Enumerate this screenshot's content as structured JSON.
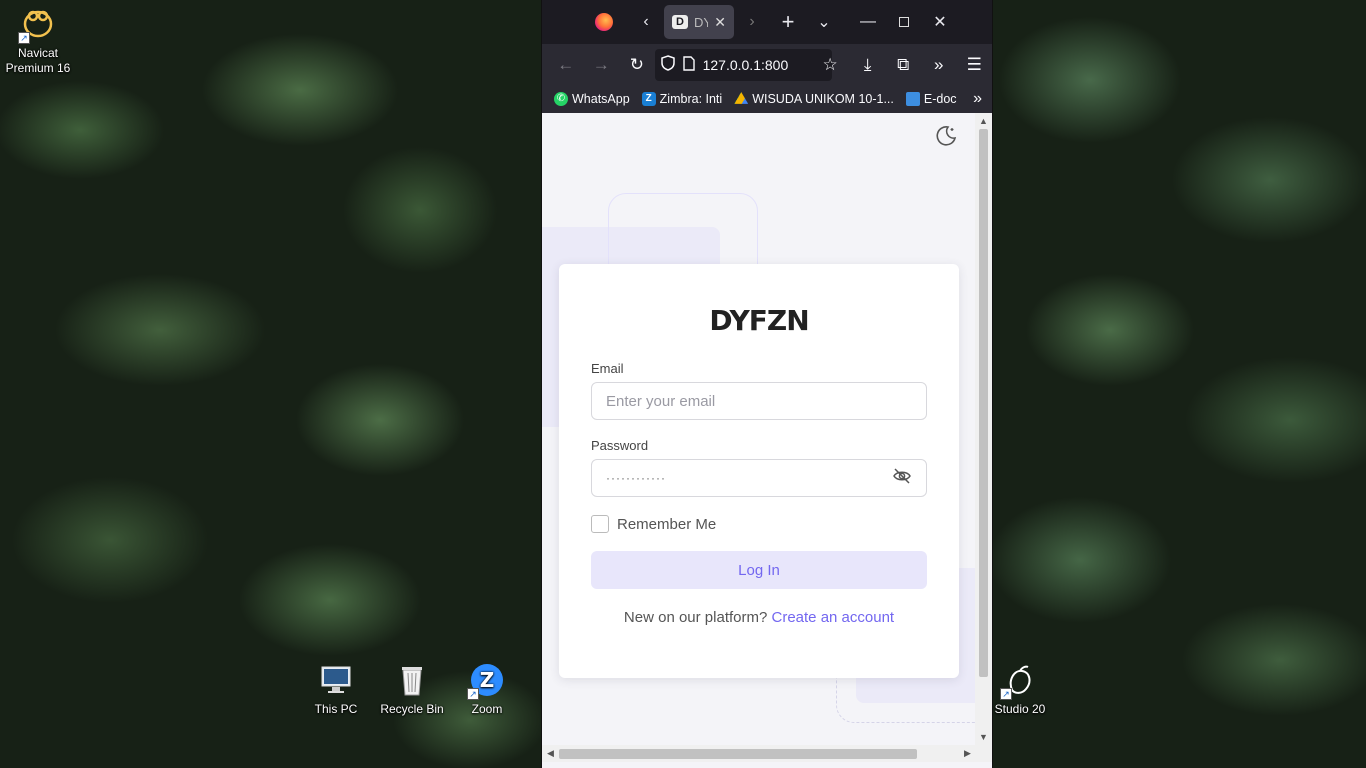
{
  "desktop": {
    "icons": [
      {
        "label": "Navicat\nPremium 16",
        "icon": "navicat-icon"
      },
      {
        "label": "This PC",
        "icon": "computer-icon"
      },
      {
        "label": "Recycle Bin",
        "icon": "recycle-bin-icon"
      },
      {
        "label": "Zoom",
        "icon": "zoom-icon"
      },
      {
        "label": "Studio 20",
        "icon": "studio-icon"
      }
    ]
  },
  "browser": {
    "tab": {
      "title": "DY",
      "favicon": "D"
    },
    "url": "127.0.0.1:800",
    "bookmarks": [
      {
        "label": "WhatsApp",
        "icon": "whatsapp-icon",
        "color": "#25d366"
      },
      {
        "label": "Zimbra: Inti",
        "icon": "zimbra-icon",
        "color": "#1a7fd4"
      },
      {
        "label": "WISUDA UNIKOM 10-1...",
        "icon": "drive-icon",
        "color": "#f4b400"
      },
      {
        "label": "E-doc",
        "icon": "folder-icon",
        "color": "#3d8ee0"
      }
    ]
  },
  "login": {
    "brand": "DYFZN",
    "email_label": "Email",
    "email_placeholder": "Enter your email",
    "password_label": "Password",
    "password_value": "············",
    "remember_label": "Remember Me",
    "login_button": "Log In",
    "signup_prompt": "New on our platform?",
    "signup_link": "Create an account"
  },
  "colors": {
    "accent": "#7367f0",
    "button_bg": "#e8e6fb"
  }
}
